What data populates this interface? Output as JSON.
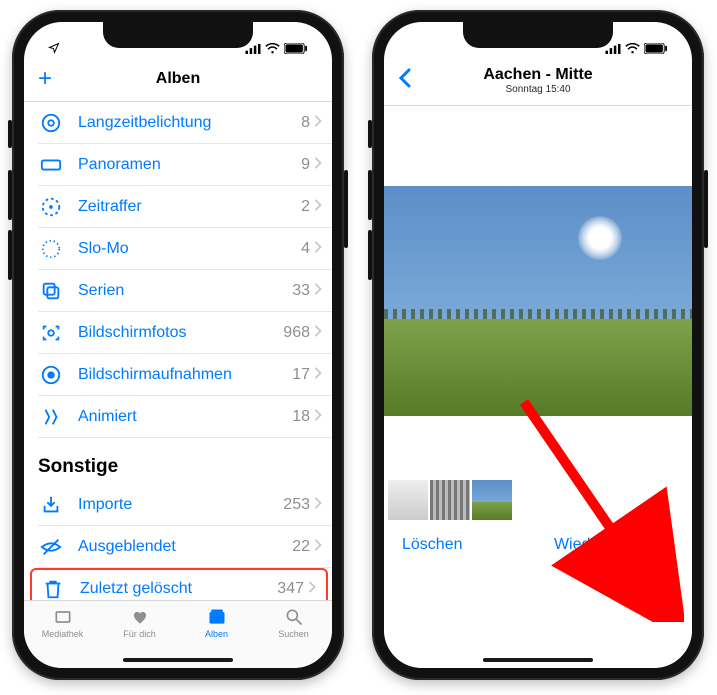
{
  "status": {
    "signal_icon": "signal",
    "wifi_icon": "wifi",
    "battery_icon": "battery"
  },
  "left": {
    "title": "Alben",
    "add_glyph": "+",
    "rows": [
      {
        "icon": "long-exposure",
        "label": "Langzeitbelichtung",
        "count": "8"
      },
      {
        "icon": "panorama",
        "label": "Panoramen",
        "count": "9"
      },
      {
        "icon": "timelapse",
        "label": "Zeitraffer",
        "count": "2"
      },
      {
        "icon": "slomo",
        "label": "Slo-Mo",
        "count": "4"
      },
      {
        "icon": "burst",
        "label": "Serien",
        "count": "33"
      },
      {
        "icon": "screenshot",
        "label": "Bildschirmfotos",
        "count": "968"
      },
      {
        "icon": "screenrec",
        "label": "Bildschirmaufnahmen",
        "count": "17"
      },
      {
        "icon": "animated",
        "label": "Animiert",
        "count": "18"
      }
    ],
    "section_other": "Sonstige",
    "other_rows": [
      {
        "icon": "import",
        "label": "Importe",
        "count": "253"
      },
      {
        "icon": "hidden",
        "label": "Ausgeblendet",
        "count": "22"
      },
      {
        "icon": "trash",
        "label": "Zuletzt gelöscht",
        "count": "347",
        "highlight": true
      }
    ],
    "tabs": [
      {
        "key": "library",
        "label": "Mediathek"
      },
      {
        "key": "foryou",
        "label": "Für dich"
      },
      {
        "key": "albums",
        "label": "Alben",
        "active": true
      },
      {
        "key": "search",
        "label": "Suchen"
      }
    ]
  },
  "right": {
    "title": "Aachen - Mitte",
    "subtitle": "Sonntag 15:40",
    "delete_label": "Löschen",
    "restore_label": "Wiederherstellen"
  }
}
